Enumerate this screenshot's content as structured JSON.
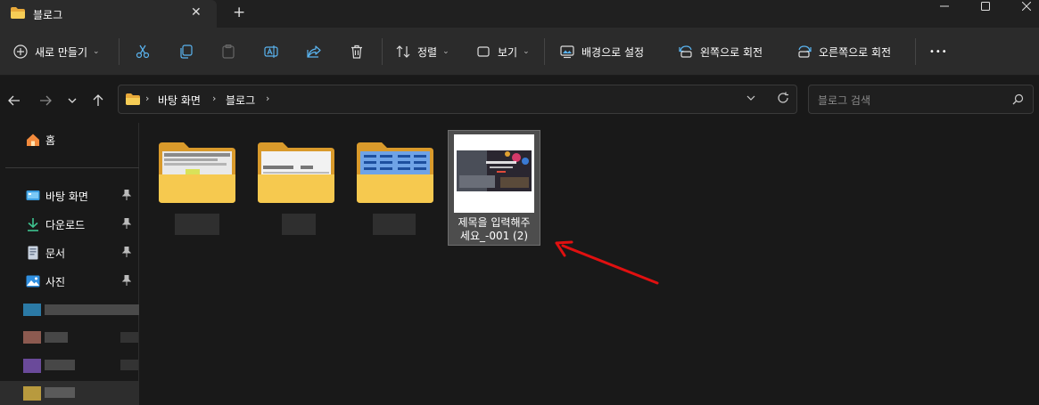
{
  "window": {
    "tab_title": "블로그",
    "tab_close": "✕",
    "new_tab": "+",
    "min": "—",
    "max": "☐",
    "close": "✕"
  },
  "toolbar": {
    "new_label": "새로 만들기",
    "sort_label": "정렬",
    "view_label": "보기",
    "background_label": "배경으로 설정",
    "rotate_left_label": "왼쪽으로 회전",
    "rotate_right_label": "오른쪽으로 회전",
    "more": "•••",
    "chevron": "⌄"
  },
  "address": {
    "crumbs": [
      "바탕 화면",
      "블로그"
    ],
    "separator": "›"
  },
  "search": {
    "placeholder": "블로그 검색"
  },
  "sidebar": {
    "home": "홈",
    "items": [
      {
        "label": "바탕 화면",
        "icon": "desktop-icon"
      },
      {
        "label": "다운로드",
        "icon": "download-icon"
      },
      {
        "label": "문서",
        "icon": "document-icon"
      },
      {
        "label": "사진",
        "icon": "pictures-icon"
      }
    ]
  },
  "files": {
    "selected_line1": "제목을 입력해주",
    "selected_line2": "세요_-001 (2)"
  },
  "colors": {
    "accent_folder": "#f2c14e",
    "selection": "#4d4d4d",
    "annotation_arrow": "#e01010"
  }
}
